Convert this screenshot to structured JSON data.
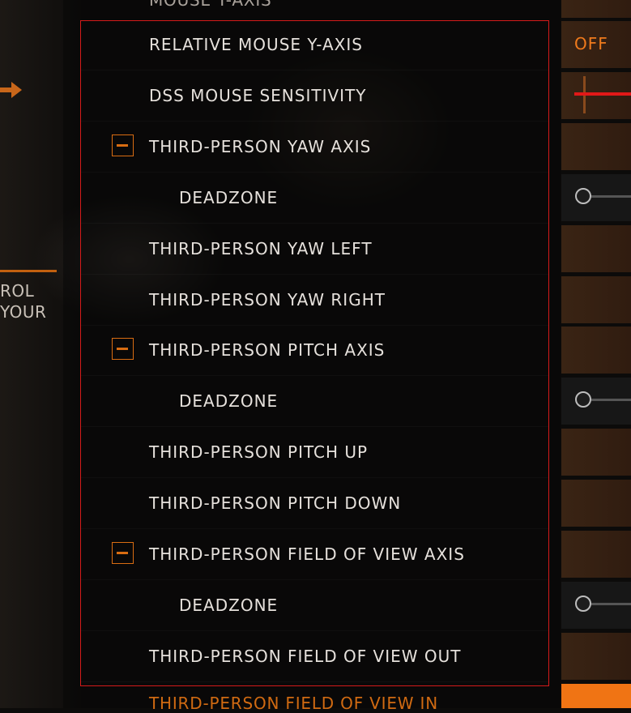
{
  "left_panel": {
    "text_line_1": "ROL",
    "text_line_2": "YOUR"
  },
  "list": {
    "top_partial_label": "MOUSE Y-AXIS",
    "bottom_partial_label": "THIRD-PERSON FIELD OF VIEW IN",
    "items": [
      {
        "label": "RELATIVE MOUSE Y-AXIS",
        "indent": false,
        "collapsible": false,
        "control": "toggle",
        "value": "OFF"
      },
      {
        "label": "DSS MOUSE SENSITIVITY",
        "indent": false,
        "collapsible": false,
        "control": "sensitivity"
      },
      {
        "label": "THIRD-PERSON YAW AXIS",
        "indent": false,
        "collapsible": true,
        "control": "binding"
      },
      {
        "label": "DEADZONE",
        "indent": true,
        "collapsible": false,
        "control": "slider",
        "value": 0
      },
      {
        "label": "THIRD-PERSON YAW LEFT",
        "indent": false,
        "collapsible": false,
        "control": "binding"
      },
      {
        "label": "THIRD-PERSON YAW RIGHT",
        "indent": false,
        "collapsible": false,
        "control": "binding"
      },
      {
        "label": "THIRD-PERSON PITCH AXIS",
        "indent": false,
        "collapsible": true,
        "control": "binding"
      },
      {
        "label": "DEADZONE",
        "indent": true,
        "collapsible": false,
        "control": "slider",
        "value": 0
      },
      {
        "label": "THIRD-PERSON PITCH UP",
        "indent": false,
        "collapsible": false,
        "control": "binding"
      },
      {
        "label": "THIRD-PERSON PITCH DOWN",
        "indent": false,
        "collapsible": false,
        "control": "binding"
      },
      {
        "label": "THIRD-PERSON FIELD OF VIEW AXIS",
        "indent": false,
        "collapsible": true,
        "control": "binding"
      },
      {
        "label": "DEADZONE",
        "indent": true,
        "collapsible": false,
        "control": "slider",
        "value": 0
      },
      {
        "label": "THIRD-PERSON FIELD OF VIEW OUT",
        "indent": false,
        "collapsible": false,
        "control": "binding"
      }
    ]
  },
  "colors": {
    "accent_orange": "#d96d12",
    "selection_frame": "#d41a1a",
    "label_text": "#e6e1dc"
  }
}
